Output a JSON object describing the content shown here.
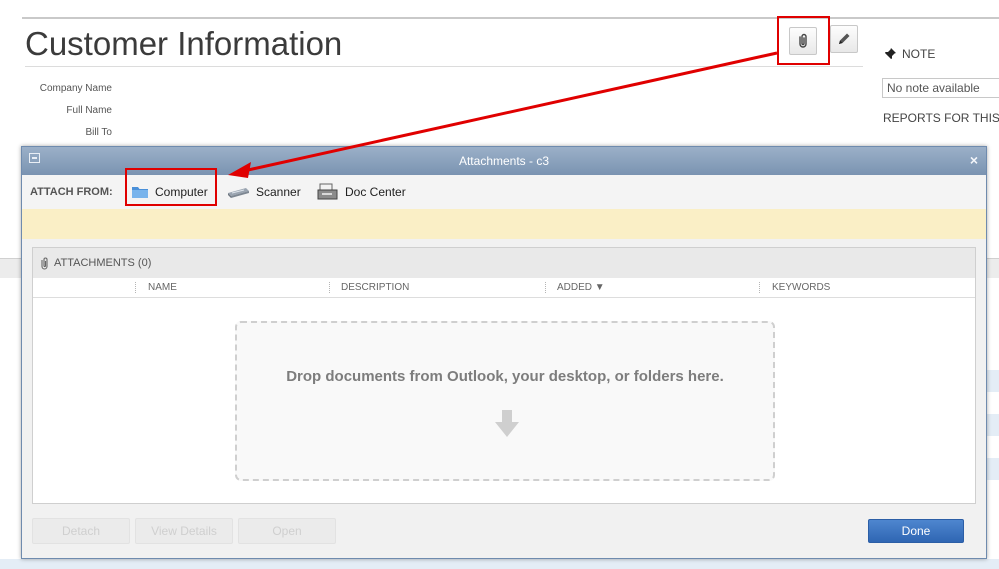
{
  "customer": {
    "title": "Customer Information",
    "fields": [
      "Company Name",
      "Full Name",
      "Bill To"
    ]
  },
  "note": {
    "heading": "NOTE",
    "placeholder": "No note available"
  },
  "reports_label": "REPORTS FOR THIS",
  "dialog": {
    "title": "Attachments - c3",
    "attach_from_label": "ATTACH FROM:",
    "sources": [
      "Computer",
      "Scanner",
      "Doc Center"
    ],
    "attachments_header": "ATTACHMENTS (0)",
    "columns": [
      "NAME",
      "DESCRIPTION",
      "ADDED ▼",
      "KEYWORDS"
    ],
    "drop_text": "Drop documents from Outlook, your desktop, or folders here.",
    "buttons": {
      "detach": "Detach",
      "view_details": "View Details",
      "open": "Open",
      "done": "Done"
    }
  },
  "colors": {
    "annotation_red": "#e00000",
    "titlebar": "#7a93b1",
    "done_button": "#2f66b3",
    "notice_yellow": "#faefc6"
  },
  "icons": [
    "paperclip-icon",
    "pencil-icon",
    "pushpin-icon",
    "folder-icon",
    "scanner-icon",
    "doc-center-icon",
    "down-arrow-icon"
  ]
}
